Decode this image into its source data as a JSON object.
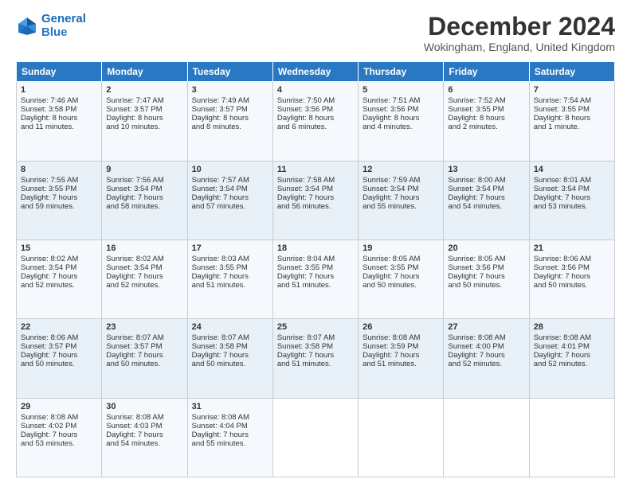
{
  "header": {
    "logo_line1": "General",
    "logo_line2": "Blue",
    "month_title": "December 2024",
    "location": "Wokingham, England, United Kingdom"
  },
  "weekdays": [
    "Sunday",
    "Monday",
    "Tuesday",
    "Wednesday",
    "Thursday",
    "Friday",
    "Saturday"
  ],
  "weeks": [
    [
      {
        "day": "1",
        "lines": [
          "Sunrise: 7:46 AM",
          "Sunset: 3:58 PM",
          "Daylight: 8 hours",
          "and 11 minutes."
        ]
      },
      {
        "day": "2",
        "lines": [
          "Sunrise: 7:47 AM",
          "Sunset: 3:57 PM",
          "Daylight: 8 hours",
          "and 10 minutes."
        ]
      },
      {
        "day": "3",
        "lines": [
          "Sunrise: 7:49 AM",
          "Sunset: 3:57 PM",
          "Daylight: 8 hours",
          "and 8 minutes."
        ]
      },
      {
        "day": "4",
        "lines": [
          "Sunrise: 7:50 AM",
          "Sunset: 3:56 PM",
          "Daylight: 8 hours",
          "and 6 minutes."
        ]
      },
      {
        "day": "5",
        "lines": [
          "Sunrise: 7:51 AM",
          "Sunset: 3:56 PM",
          "Daylight: 8 hours",
          "and 4 minutes."
        ]
      },
      {
        "day": "6",
        "lines": [
          "Sunrise: 7:52 AM",
          "Sunset: 3:55 PM",
          "Daylight: 8 hours",
          "and 2 minutes."
        ]
      },
      {
        "day": "7",
        "lines": [
          "Sunrise: 7:54 AM",
          "Sunset: 3:55 PM",
          "Daylight: 8 hours",
          "and 1 minute."
        ]
      }
    ],
    [
      {
        "day": "8",
        "lines": [
          "Sunrise: 7:55 AM",
          "Sunset: 3:55 PM",
          "Daylight: 7 hours",
          "and 59 minutes."
        ]
      },
      {
        "day": "9",
        "lines": [
          "Sunrise: 7:56 AM",
          "Sunset: 3:54 PM",
          "Daylight: 7 hours",
          "and 58 minutes."
        ]
      },
      {
        "day": "10",
        "lines": [
          "Sunrise: 7:57 AM",
          "Sunset: 3:54 PM",
          "Daylight: 7 hours",
          "and 57 minutes."
        ]
      },
      {
        "day": "11",
        "lines": [
          "Sunrise: 7:58 AM",
          "Sunset: 3:54 PM",
          "Daylight: 7 hours",
          "and 56 minutes."
        ]
      },
      {
        "day": "12",
        "lines": [
          "Sunrise: 7:59 AM",
          "Sunset: 3:54 PM",
          "Daylight: 7 hours",
          "and 55 minutes."
        ]
      },
      {
        "day": "13",
        "lines": [
          "Sunrise: 8:00 AM",
          "Sunset: 3:54 PM",
          "Daylight: 7 hours",
          "and 54 minutes."
        ]
      },
      {
        "day": "14",
        "lines": [
          "Sunrise: 8:01 AM",
          "Sunset: 3:54 PM",
          "Daylight: 7 hours",
          "and 53 minutes."
        ]
      }
    ],
    [
      {
        "day": "15",
        "lines": [
          "Sunrise: 8:02 AM",
          "Sunset: 3:54 PM",
          "Daylight: 7 hours",
          "and 52 minutes."
        ]
      },
      {
        "day": "16",
        "lines": [
          "Sunrise: 8:02 AM",
          "Sunset: 3:54 PM",
          "Daylight: 7 hours",
          "and 52 minutes."
        ]
      },
      {
        "day": "17",
        "lines": [
          "Sunrise: 8:03 AM",
          "Sunset: 3:55 PM",
          "Daylight: 7 hours",
          "and 51 minutes."
        ]
      },
      {
        "day": "18",
        "lines": [
          "Sunrise: 8:04 AM",
          "Sunset: 3:55 PM",
          "Daylight: 7 hours",
          "and 51 minutes."
        ]
      },
      {
        "day": "19",
        "lines": [
          "Sunrise: 8:05 AM",
          "Sunset: 3:55 PM",
          "Daylight: 7 hours",
          "and 50 minutes."
        ]
      },
      {
        "day": "20",
        "lines": [
          "Sunrise: 8:05 AM",
          "Sunset: 3:56 PM",
          "Daylight: 7 hours",
          "and 50 minutes."
        ]
      },
      {
        "day": "21",
        "lines": [
          "Sunrise: 8:06 AM",
          "Sunset: 3:56 PM",
          "Daylight: 7 hours",
          "and 50 minutes."
        ]
      }
    ],
    [
      {
        "day": "22",
        "lines": [
          "Sunrise: 8:06 AM",
          "Sunset: 3:57 PM",
          "Daylight: 7 hours",
          "and 50 minutes."
        ]
      },
      {
        "day": "23",
        "lines": [
          "Sunrise: 8:07 AM",
          "Sunset: 3:57 PM",
          "Daylight: 7 hours",
          "and 50 minutes."
        ]
      },
      {
        "day": "24",
        "lines": [
          "Sunrise: 8:07 AM",
          "Sunset: 3:58 PM",
          "Daylight: 7 hours",
          "and 50 minutes."
        ]
      },
      {
        "day": "25",
        "lines": [
          "Sunrise: 8:07 AM",
          "Sunset: 3:58 PM",
          "Daylight: 7 hours",
          "and 51 minutes."
        ]
      },
      {
        "day": "26",
        "lines": [
          "Sunrise: 8:08 AM",
          "Sunset: 3:59 PM",
          "Daylight: 7 hours",
          "and 51 minutes."
        ]
      },
      {
        "day": "27",
        "lines": [
          "Sunrise: 8:08 AM",
          "Sunset: 4:00 PM",
          "Daylight: 7 hours",
          "and 52 minutes."
        ]
      },
      {
        "day": "28",
        "lines": [
          "Sunrise: 8:08 AM",
          "Sunset: 4:01 PM",
          "Daylight: 7 hours",
          "and 52 minutes."
        ]
      }
    ],
    [
      {
        "day": "29",
        "lines": [
          "Sunrise: 8:08 AM",
          "Sunset: 4:02 PM",
          "Daylight: 7 hours",
          "and 53 minutes."
        ]
      },
      {
        "day": "30",
        "lines": [
          "Sunrise: 8:08 AM",
          "Sunset: 4:03 PM",
          "Daylight: 7 hours",
          "and 54 minutes."
        ]
      },
      {
        "day": "31",
        "lines": [
          "Sunrise: 8:08 AM",
          "Sunset: 4:04 PM",
          "Daylight: 7 hours",
          "and 55 minutes."
        ]
      },
      {
        "day": "",
        "lines": []
      },
      {
        "day": "",
        "lines": []
      },
      {
        "day": "",
        "lines": []
      },
      {
        "day": "",
        "lines": []
      }
    ]
  ]
}
